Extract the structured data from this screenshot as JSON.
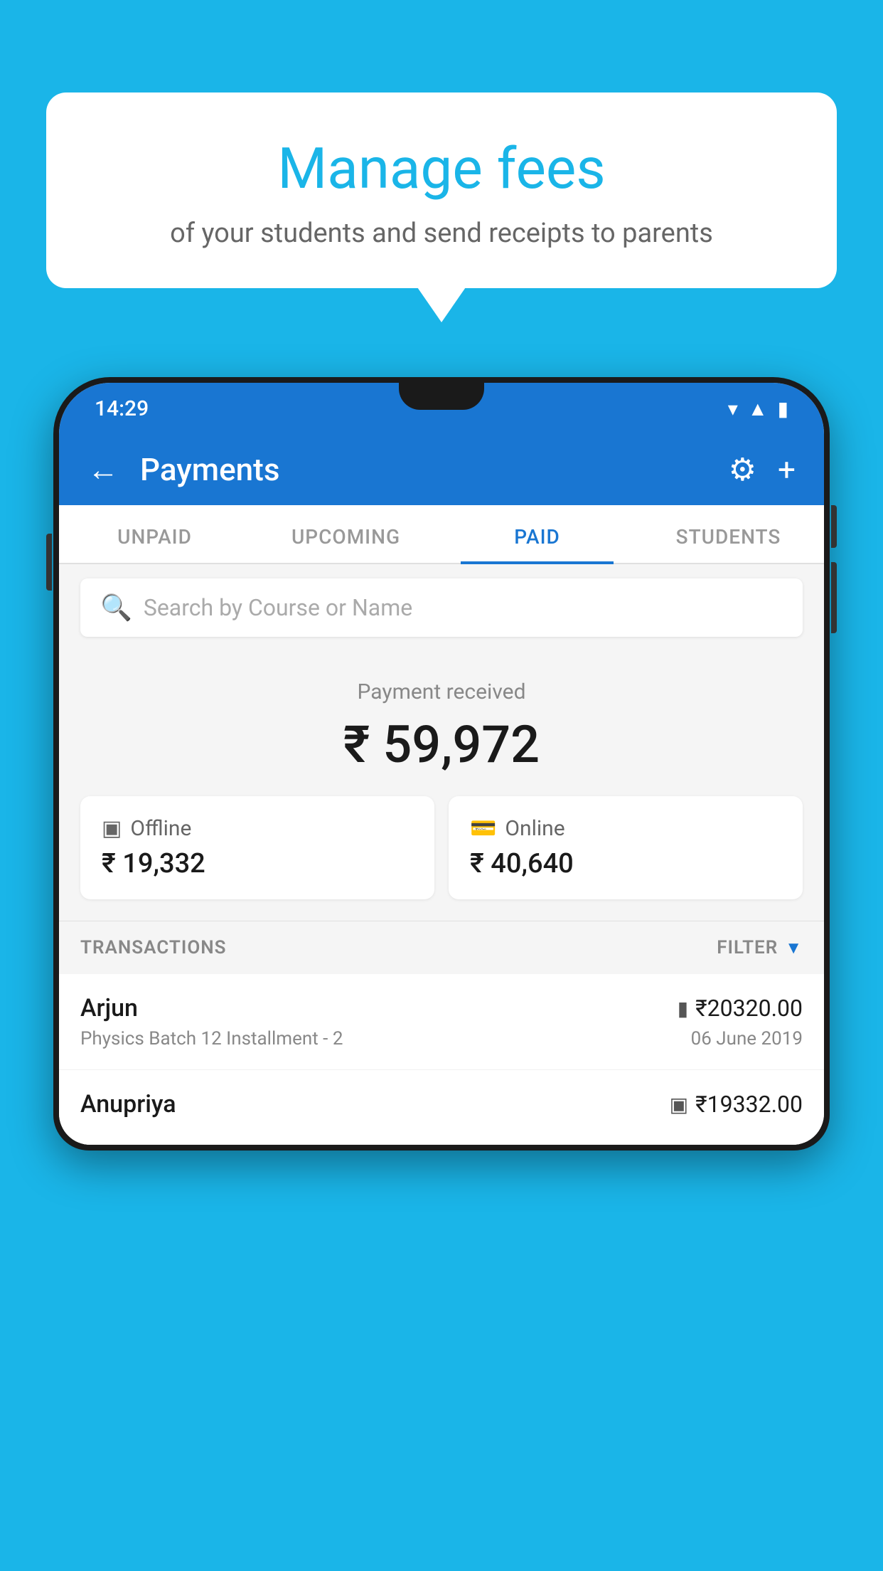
{
  "background_color": "#1ab5e8",
  "bubble": {
    "title": "Manage fees",
    "subtitle": "of your students and send receipts to parents"
  },
  "phone": {
    "status_bar": {
      "time": "14:29",
      "wifi": "▼",
      "signal": "▲",
      "battery": "▮"
    },
    "app_bar": {
      "back_label": "←",
      "title": "Payments",
      "gear_label": "⚙",
      "plus_label": "+"
    },
    "tabs": [
      {
        "label": "UNPAID",
        "active": false
      },
      {
        "label": "UPCOMING",
        "active": false
      },
      {
        "label": "PAID",
        "active": true
      },
      {
        "label": "STUDENTS",
        "active": false
      }
    ],
    "search": {
      "placeholder": "Search by Course or Name"
    },
    "payment_summary": {
      "label": "Payment received",
      "amount": "₹ 59,972",
      "offline_label": "Offline",
      "offline_amount": "₹ 19,332",
      "online_label": "Online",
      "online_amount": "₹ 40,640"
    },
    "transactions": {
      "section_label": "TRANSACTIONS",
      "filter_label": "FILTER",
      "items": [
        {
          "name": "Arjun",
          "detail": "Physics Batch 12 Installment - 2",
          "amount": "₹20320.00",
          "date": "06 June 2019",
          "payment_type": "online"
        },
        {
          "name": "Anupriya",
          "detail": "",
          "amount": "₹19332.00",
          "date": "",
          "payment_type": "offline"
        }
      ]
    }
  }
}
